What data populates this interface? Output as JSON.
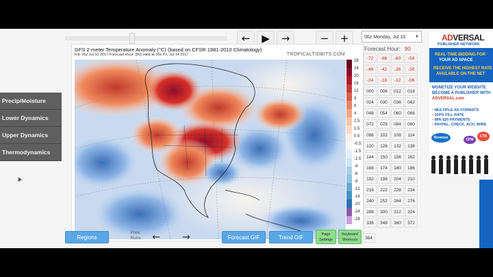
{
  "toolbar": {
    "prev_icon": "arrow-left-icon",
    "play_icon": "play-icon",
    "next_icon": "arrow-right-icon",
    "zoom_out_label": "−",
    "zoom_in_label": "+",
    "run_select_value": "06z Monday, Jul 10",
    "forecast_hour_label": "Forecast Hour:",
    "forecast_hour_value": "90"
  },
  "sidebar": {
    "items": [
      {
        "label": "Precip/Moisture"
      },
      {
        "label": "Lower Dynamics"
      },
      {
        "label": "Upper Dynamics"
      },
      {
        "label": "Thermodynamics"
      }
    ]
  },
  "map": {
    "title": "GFS 2-meter Temperature Anomaly (°C) (based on CFSR 1981-2010 Climatology)",
    "subtitle": "Init: 06z Jul 10 2017   Forecast Hour: [90]   valid at 00z Fri, Jul 14 2017",
    "credit": "TROPICALTIDBITS.COM",
    "colorbar_labels": [
      "28",
      "24",
      "20",
      "16",
      "12",
      "9",
      "6",
      "4",
      "2.5",
      "1.5",
      "0.5",
      "-0.5",
      "-1.5",
      "-2.5",
      "-4",
      "-6",
      "-9",
      "-12",
      "-16",
      "-20",
      "-24",
      "-28"
    ],
    "colors": {
      "warm": "#d73027",
      "hot": "#a50026",
      "cool": "#4575b4",
      "neutral": "#f7f7f7"
    }
  },
  "forecast_hours": {
    "negative": [
      "-72",
      "-66",
      "-60",
      "-54",
      "-48",
      "-42",
      "-36",
      "-30",
      "-24",
      "-18",
      "-12",
      "-06"
    ],
    "positive": [
      "000",
      "006",
      "012",
      "018",
      "024",
      "030",
      "036",
      "042",
      "048",
      "054",
      "060",
      "066",
      "072",
      "078",
      "084",
      "090",
      "096",
      "102",
      "108",
      "114",
      "120",
      "126",
      "132",
      "138",
      "144",
      "150",
      "156",
      "162",
      "168",
      "174",
      "180",
      "186",
      "192",
      "198",
      "204",
      "210",
      "216",
      "222",
      "228",
      "234",
      "240",
      "252",
      "264",
      "276",
      "288",
      "300",
      "312",
      "324",
      "336",
      "348",
      "360",
      "372"
    ],
    "last": "384"
  },
  "bottom": {
    "regions_label": "Regions",
    "prev_runs_label": "Prev. Runs",
    "forecast_gif_label": "Forecast GIF",
    "trend_gif_label": "Trend GIF",
    "page_settings_label": "Page Settings",
    "keyboard_shortcuts_label": "Keyboard Shortcuts"
  },
  "ad": {
    "logo_a": "AD",
    "logo_b": "VERSAL",
    "network": "PUBLISHER NETWORK",
    "blue_1": "REAL-TIME BIDDING FOR",
    "blue_2": "YOUR AD SPACE",
    "blue_3": "RECEIVE THE HIGHEST RATE",
    "blue_4": "AVAILABLE ON THE NET",
    "mid_1": "MONETIZE YOUR WEBSITE",
    "mid_2": "BECOME A PUBLISHER WITH",
    "mid_3": "ADVERSAL.com",
    "list_1": "MULTIPLE AD FORMATS",
    "list_2": "100% FILL RATE",
    "list_3": "MIN $20 PAYMENTS",
    "list_4": "PAYPAL, CHECK, ACH, WIRE",
    "bubble_1": "Revenue",
    "bubble_2": "CPM",
    "bubble_3": "CTR"
  }
}
